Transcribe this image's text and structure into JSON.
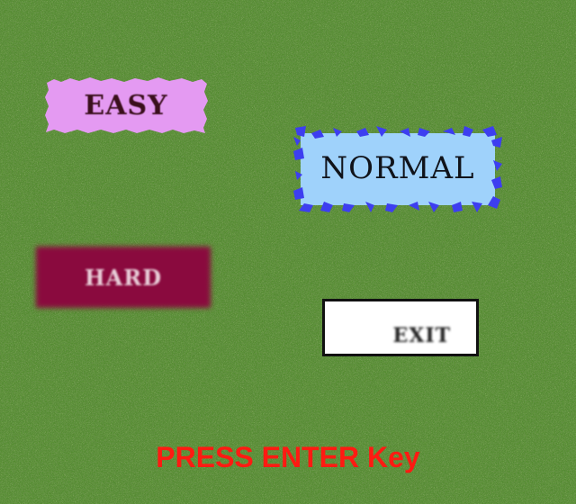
{
  "menu": {
    "easy_label": "EASY",
    "normal_label": "NORMAL",
    "hard_label": "HARD",
    "exit_label": "EXIT",
    "selected": "normal"
  },
  "prompt": {
    "text": "PRESS ENTER Key"
  },
  "colors": {
    "grass": "#4f8a2a",
    "easy_bg": "#e49af2",
    "normal_bg": "#9fd2fb",
    "normal_chips": "#3d3ef0",
    "hard_bg": "#8a0a3e",
    "exit_bg": "#ffffff",
    "prompt": "#ff1a12"
  }
}
